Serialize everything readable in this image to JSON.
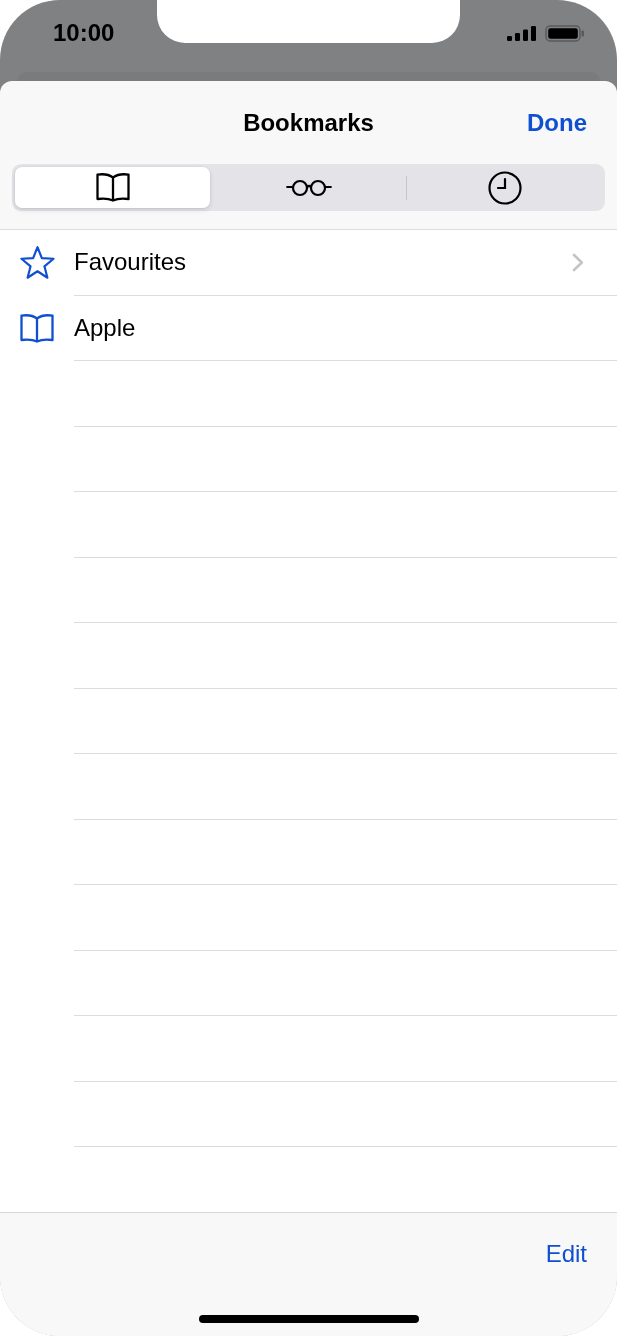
{
  "status_bar": {
    "time": "10:00"
  },
  "header": {
    "title": "Bookmarks",
    "done": "Done"
  },
  "tabs": [
    {
      "kind": "bookmarks",
      "selected": true
    },
    {
      "kind": "reading_list",
      "selected": false
    },
    {
      "kind": "history",
      "selected": false
    }
  ],
  "items": [
    {
      "kind": "favourites",
      "title": "Favourites"
    },
    {
      "kind": "bookmark",
      "title": "Apple"
    }
  ],
  "toolbar": {
    "edit": "Edit"
  }
}
